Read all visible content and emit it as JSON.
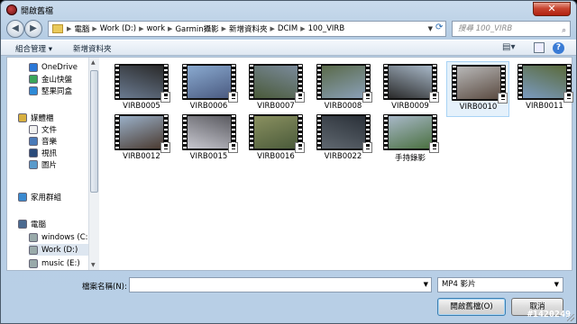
{
  "window": {
    "title": "開啟舊檔",
    "close_label": "✕"
  },
  "nav": {
    "back": "◀",
    "forward": "▶"
  },
  "address": {
    "crumbs": [
      "電腦",
      "Work (D:)",
      "work",
      "Garmin攝影",
      "新增資料夾",
      "DCIM",
      "100_VIRB"
    ],
    "separator": "▶"
  },
  "search": {
    "placeholder": "搜尋 100_VIRB"
  },
  "toolbar": {
    "organize_label": "組合管理 ▾",
    "new_folder_label": "新增資料夾"
  },
  "sidebar": {
    "items": [
      {
        "label": "OneDrive",
        "icon": "cloud-icon",
        "color": "#2b78d8"
      },
      {
        "label": "金山快盤",
        "icon": "kuaipan-icon",
        "color": "#3aa55a"
      },
      {
        "label": "堅果同盒",
        "icon": "nutstore-icon",
        "color": "#2e8ad6"
      },
      {
        "label": "媒體櫃",
        "icon": "library-icon",
        "color": "#d8b040"
      },
      {
        "label": "文件",
        "icon": "documents-icon",
        "color": "#f0f0f0"
      },
      {
        "label": "音樂",
        "icon": "music-icon",
        "color": "#4a7ab8"
      },
      {
        "label": "視訊",
        "icon": "video-icon",
        "color": "#2a4a7a"
      },
      {
        "label": "圖片",
        "icon": "pictures-icon",
        "color": "#5a9acb"
      },
      {
        "label": "家用群組",
        "icon": "homegroup-icon",
        "color": "#3a8ad0"
      },
      {
        "label": "電腦",
        "icon": "computer-icon",
        "color": "#4a6a90"
      },
      {
        "label": "windows (C:)",
        "icon": "drive-icon",
        "color": "#9aa"
      },
      {
        "label": "Work (D:)",
        "icon": "drive-icon",
        "color": "#9aa"
      },
      {
        "label": "music (E:)",
        "icon": "drive-icon",
        "color": "#9aa"
      }
    ]
  },
  "files": [
    {
      "name": "VIRB0005",
      "colors": [
        "#6a7a90",
        "#2a2a2a"
      ]
    },
    {
      "name": "VIRB0006",
      "colors": [
        "#8aaad0",
        "#4a5a80"
      ]
    },
    {
      "name": "VIRB0007",
      "colors": [
        "#4a5a3a",
        "#7a8a9a"
      ]
    },
    {
      "name": "VIRB0008",
      "colors": [
        "#5a6a4a",
        "#8aa0b8"
      ]
    },
    {
      "name": "VIRB0009",
      "colors": [
        "#2a2a2a",
        "#a8b8c8"
      ]
    },
    {
      "name": "VIRB0010",
      "colors": [
        "#b8b8b8",
        "#5a4a40"
      ]
    },
    {
      "name": "VIRB0011",
      "colors": [
        "#7a9ac0",
        "#5a6a3a"
      ]
    },
    {
      "name": "VIRB0012",
      "colors": [
        "#9ab0c8",
        "#4a3a30"
      ]
    },
    {
      "name": "VIRB0015",
      "colors": [
        "#c8c8d0",
        "#5a5a60"
      ]
    },
    {
      "name": "VIRB0016",
      "colors": [
        "#8a9060",
        "#4a5a3a"
      ]
    },
    {
      "name": "VIRB0022",
      "colors": [
        "#606870",
        "#2a3038"
      ]
    },
    {
      "name": "手持錄影",
      "colors": [
        "#a8b8c8",
        "#4a7040"
      ]
    }
  ],
  "selected_file": "VIRB0010",
  "filename": {
    "label": "檔案名稱(N):",
    "value": ""
  },
  "filetype": {
    "value": "MP4 影片"
  },
  "buttons": {
    "open": "開啟舊檔(O)",
    "cancel": "取消"
  },
  "watermark": "#1420249"
}
